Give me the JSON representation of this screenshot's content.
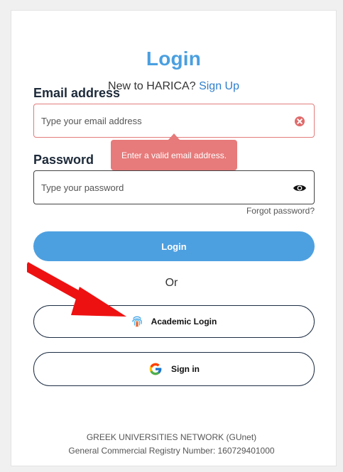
{
  "login": {
    "title": "Login",
    "new_user_prefix": "New to HARICA?",
    "signup_link": "Sign Up",
    "email_label": "Email address",
    "email_placeholder": "Type your email address",
    "email_value": "",
    "email_error": "Enter a valid email address.",
    "password_label": "Password",
    "password_placeholder": "Type your password",
    "password_value": "",
    "forgot_password": "Forgot password?",
    "login_button": "Login",
    "or_divider": "Or",
    "academic_login_button": "Academic Login",
    "google_signin_button": "Sign in"
  },
  "footer": {
    "org_name": "GREEK UNIVERSITIES NETWORK (GUnet)",
    "registry": "General Commercial Registry Number: 160729401000"
  },
  "icons": {
    "email_clear": "error-clear-icon",
    "password_toggle": "eye-icon",
    "academic": "fingerprint-icon",
    "google": "google-g-icon",
    "annotation": "red-arrow"
  },
  "colors": {
    "accent": "#4da0e0",
    "title": "#4a9fe0",
    "link": "#2f7fcc",
    "error": "#e77a7a",
    "arrow": "#ee1111",
    "outline": "#1d2d44"
  }
}
